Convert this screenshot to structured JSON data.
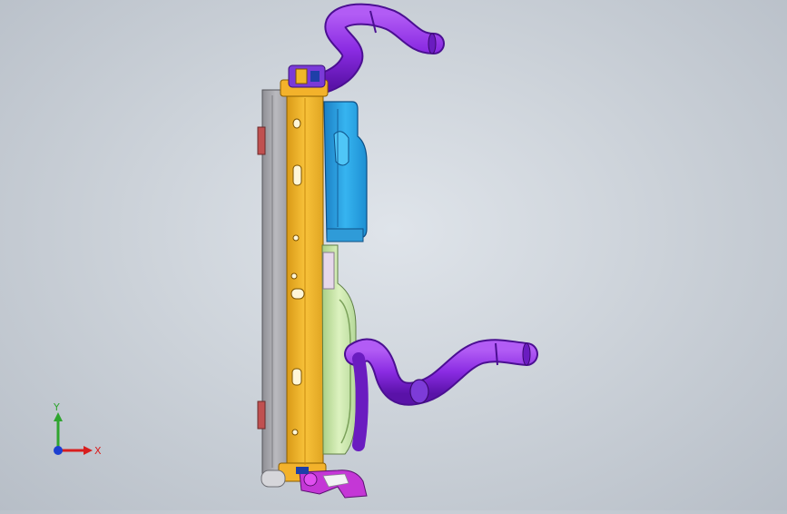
{
  "viewport": {
    "part_colors": {
      "core_frame": "#f5b82f",
      "side_plate": "#a9a9ad",
      "fan_shroud": "#c9e8a6",
      "reservoir_tank": "#29a6e8",
      "hoses": "#8a2be2",
      "bracket": "#c437d6",
      "hose_clamp": "#7d3bd8"
    }
  },
  "triad": {
    "y_label": "Y",
    "x_label": "X",
    "y_color": "#2fa52f",
    "x_color": "#d81e1e",
    "z_color": "#1c3fd1"
  }
}
